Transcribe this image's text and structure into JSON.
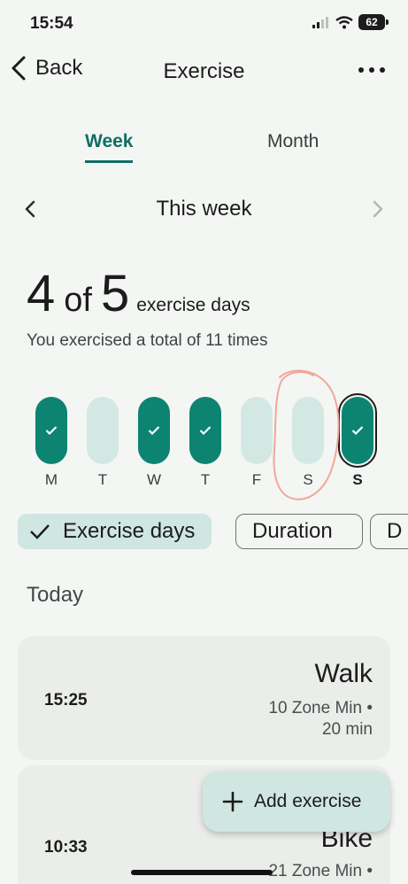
{
  "status_bar": {
    "time": "15:54",
    "battery": "62"
  },
  "nav": {
    "back_label": "Back",
    "title": "Exercise"
  },
  "tabs": [
    {
      "label": "Week",
      "selected": true
    },
    {
      "label": "Month",
      "selected": false
    }
  ],
  "week_nav": {
    "title": "This week"
  },
  "summary": {
    "count": "4",
    "of": "of",
    "target": "5",
    "unit": "exercise days",
    "subtitle": "You exercised a total of 11 times"
  },
  "days": [
    {
      "label": "M",
      "done": true
    },
    {
      "label": "T",
      "done": false
    },
    {
      "label": "W",
      "done": true
    },
    {
      "label": "T",
      "done": true
    },
    {
      "label": "F",
      "done": false
    },
    {
      "label": "S",
      "done": false
    },
    {
      "label": "S",
      "done": true,
      "today": true
    }
  ],
  "filters": {
    "exercise_days": "Exercise days",
    "duration": "Duration",
    "more": "D"
  },
  "section": {
    "today": "Today"
  },
  "activities": [
    {
      "time": "15:25",
      "name": "Walk",
      "zone": "10 Zone Min •",
      "duration": "20 min"
    },
    {
      "time": "10:33",
      "name": "Bike",
      "zone": "21 Zone Min •"
    }
  ],
  "fab": {
    "label": "Add exercise"
  },
  "colors": {
    "accent": "#0e6f62",
    "pill_on": "#0d8472",
    "pill_off": "#d4e8e3",
    "chip_selected": "#cfe6e1",
    "annotation": "#f0a898"
  }
}
